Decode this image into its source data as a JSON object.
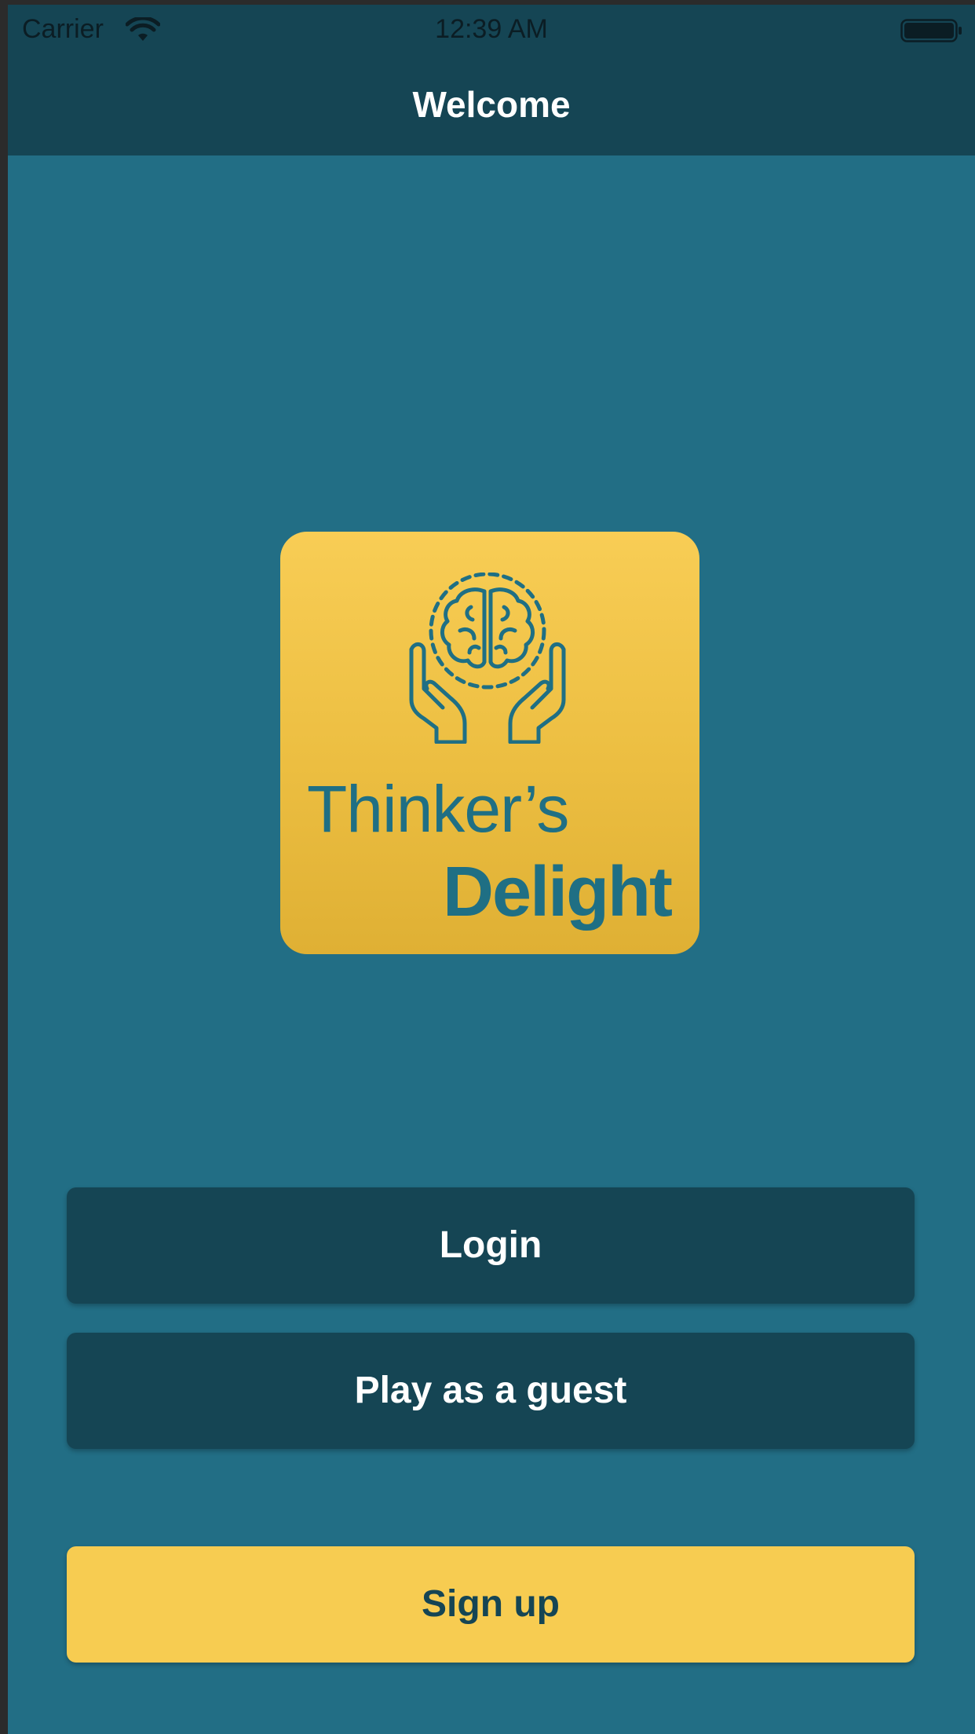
{
  "status_bar": {
    "carrier": "Carrier",
    "time": "12:39 AM",
    "wifi_icon": "wifi-icon",
    "battery_icon": "battery-icon"
  },
  "nav": {
    "title": "Welcome"
  },
  "logo": {
    "icon": "brain-in-hands-icon",
    "line1": "Thinker’s",
    "line2": "Delight"
  },
  "buttons": {
    "login": "Login",
    "guest": "Play as a guest",
    "signup": "Sign up"
  },
  "colors": {
    "background": "#226e85",
    "nav_bar": "#154554",
    "dark_button": "#154554",
    "accent_yellow": "#f7cc51"
  }
}
